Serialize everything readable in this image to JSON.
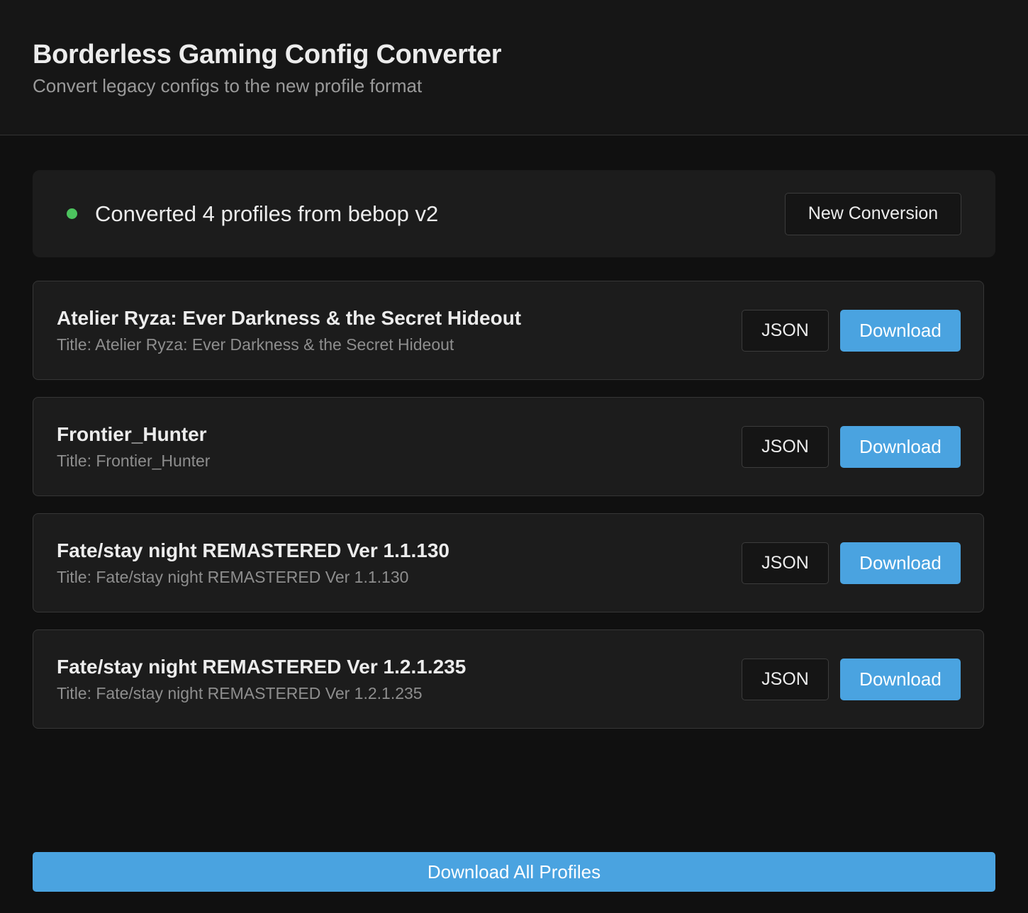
{
  "header": {
    "title": "Borderless Gaming Config Converter",
    "subtitle": "Convert legacy configs to the new profile format"
  },
  "status": {
    "message": "Converted 4 profiles from bebop v2",
    "indicator_color": "#4cc35e",
    "new_conversion_label": "New Conversion"
  },
  "profiles": [
    {
      "name": "Atelier Ryza: Ever Darkness & the Secret Hideout",
      "meta": "Title: Atelier Ryza: Ever Darkness & the Secret Hideout",
      "json_label": "JSON",
      "download_label": "Download"
    },
    {
      "name": "Frontier_Hunter",
      "meta": "Title: Frontier_Hunter",
      "json_label": "JSON",
      "download_label": "Download"
    },
    {
      "name": "Fate/stay night REMASTERED Ver 1.1.130",
      "meta": "Title: Fate/stay night REMASTERED Ver 1.1.130",
      "json_label": "JSON",
      "download_label": "Download"
    },
    {
      "name": "Fate/stay night REMASTERED Ver 1.2.1.235",
      "meta": "Title: Fate/stay night REMASTERED Ver 1.2.1.235",
      "json_label": "JSON",
      "download_label": "Download"
    }
  ],
  "footer": {
    "download_all_label": "Download All Profiles"
  },
  "colors": {
    "accent": "#4aa3e0",
    "background": "#101010",
    "card": "#1c1c1c"
  }
}
